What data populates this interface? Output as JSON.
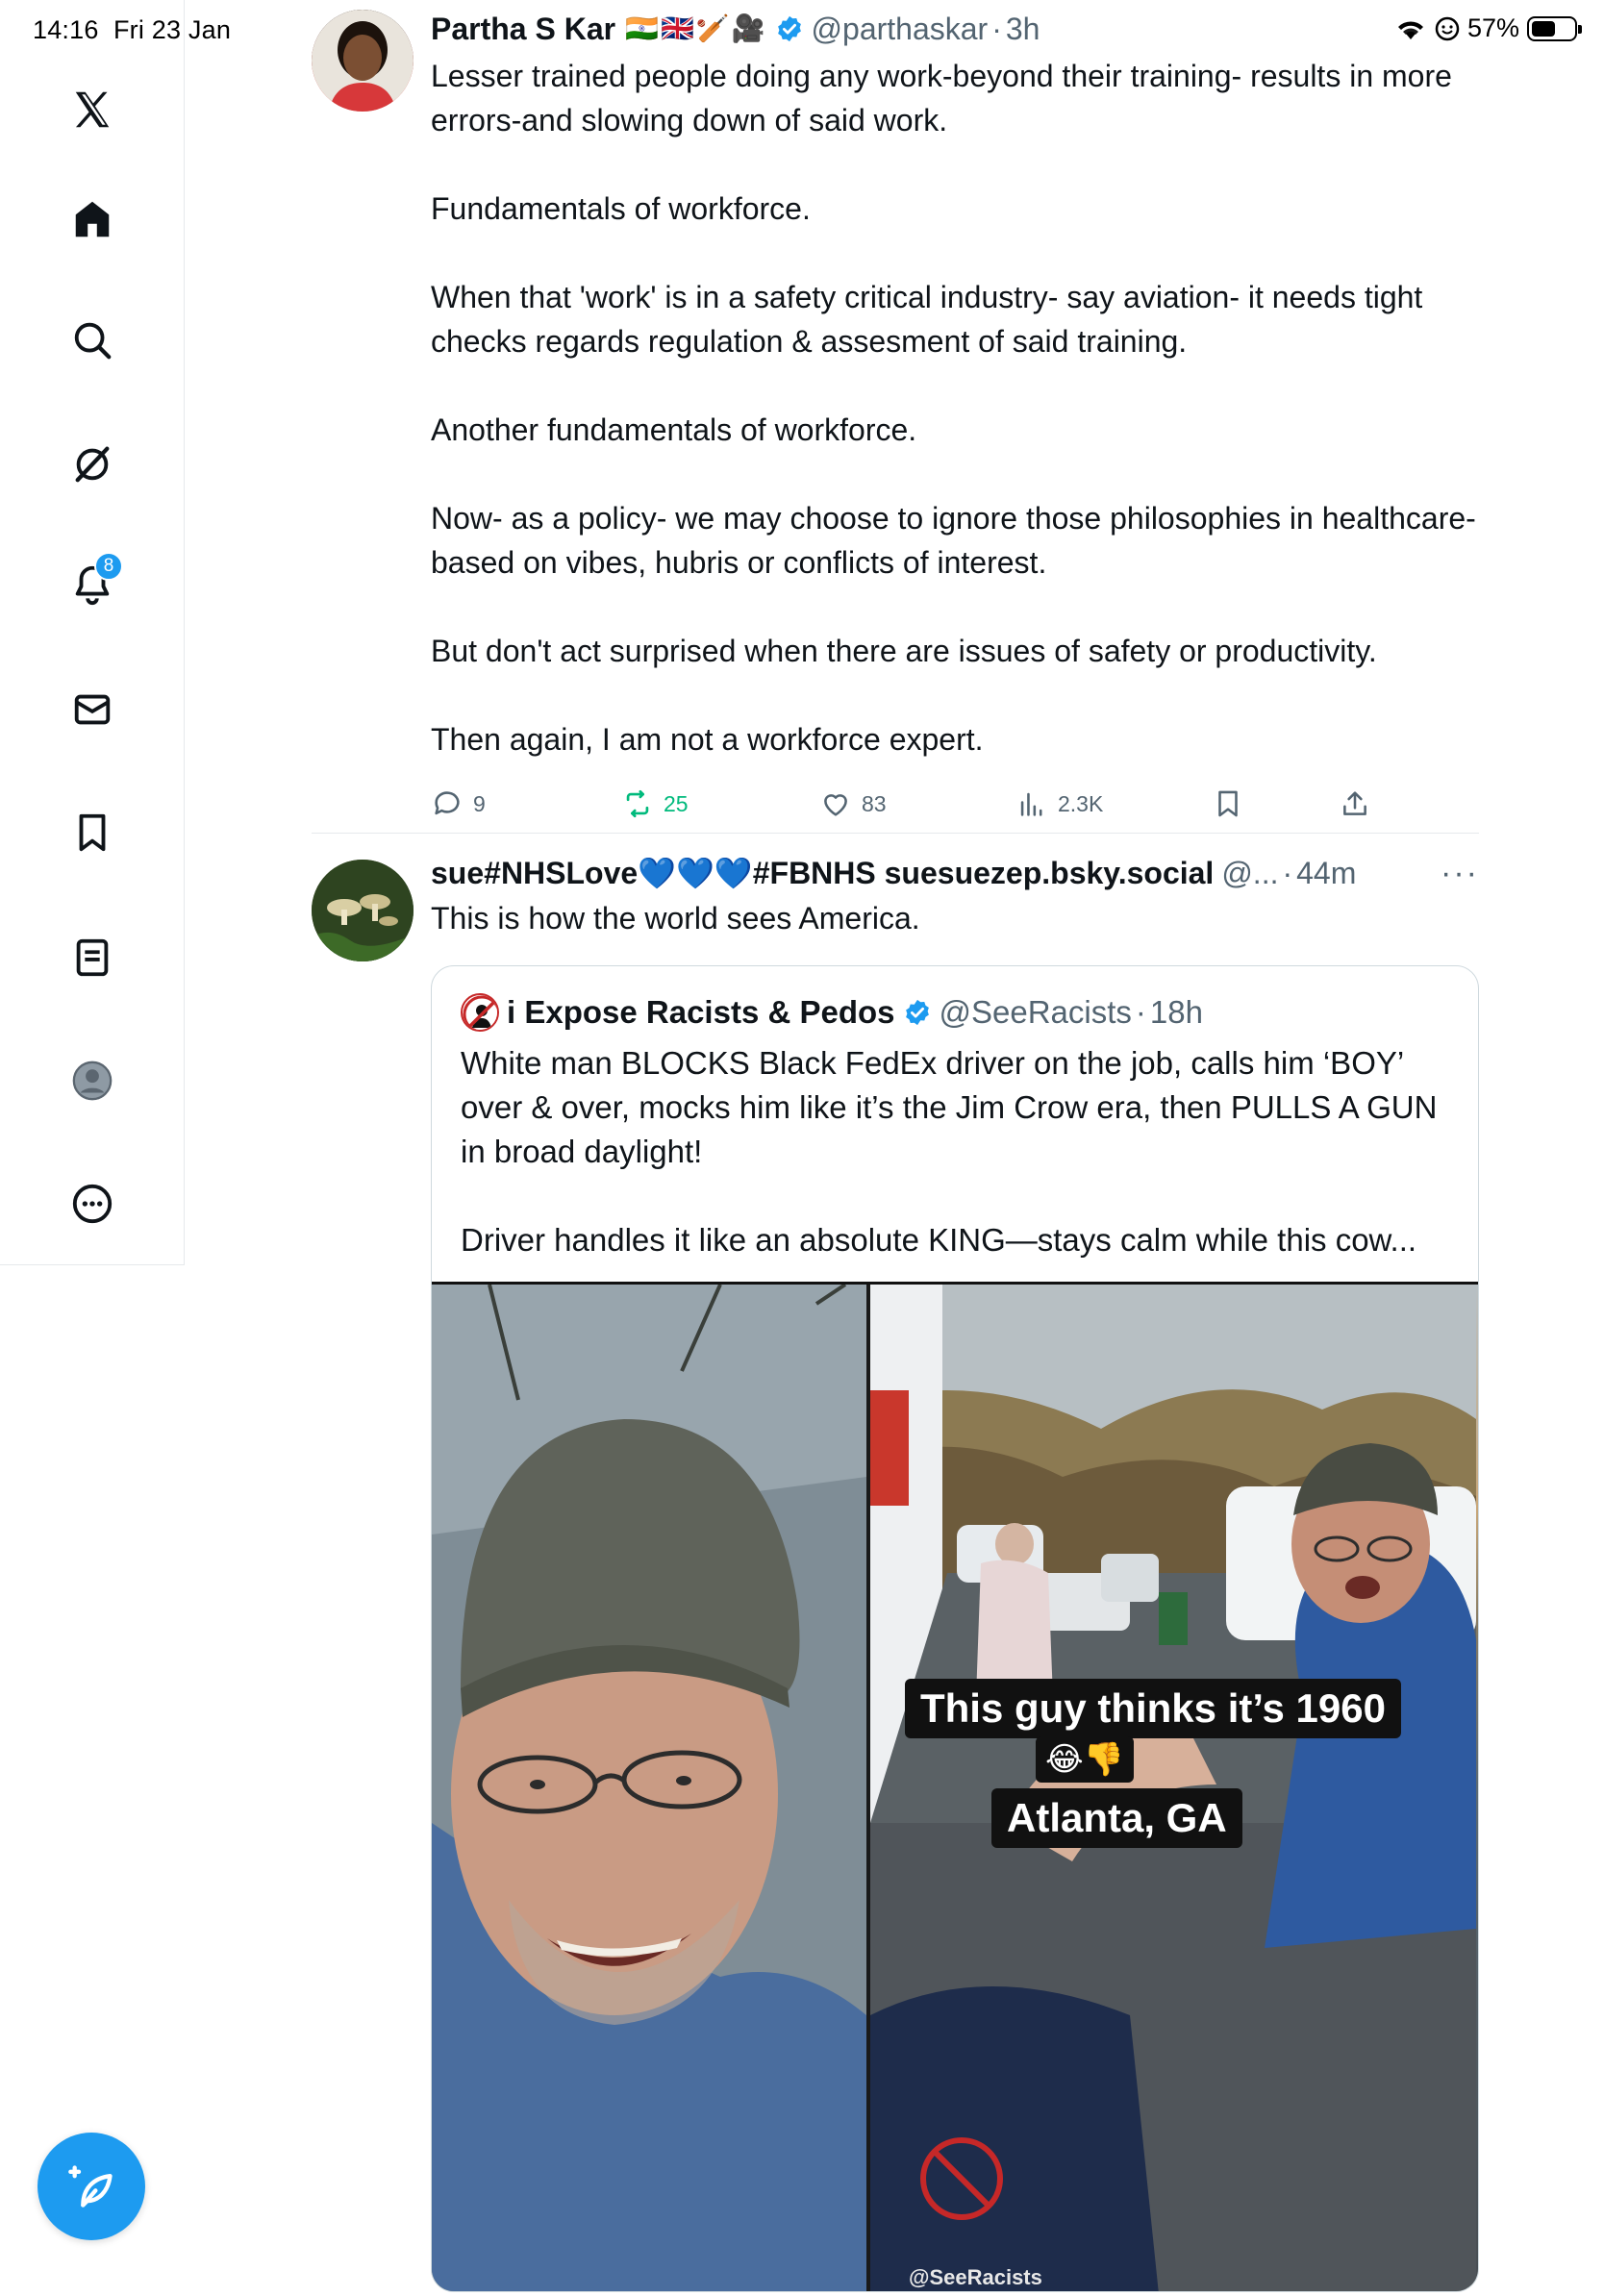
{
  "status_bar": {
    "time": "14:16",
    "date": "Fri 23 Jan",
    "battery": "57%",
    "battery_level": 0.57
  },
  "sidebar": {
    "items": [
      {
        "name": "x-logo-icon"
      },
      {
        "name": "home-icon"
      },
      {
        "name": "search-icon"
      },
      {
        "name": "grok-icon"
      },
      {
        "name": "notifications-icon",
        "badge": "8"
      },
      {
        "name": "messages-icon"
      },
      {
        "name": "bookmarks-icon"
      },
      {
        "name": "lists-icon"
      },
      {
        "name": "profile-icon"
      },
      {
        "name": "more-icon"
      }
    ],
    "compose": "compose-icon"
  },
  "tweets": [
    {
      "name": "Partha S Kar",
      "flags": "🇮🇳🇬🇧🏏🎥",
      "handle": "@parthaskar",
      "time": "3h",
      "text": "Lesser trained people doing any work-beyond their training- results in more errors-and slowing down of said work.\n\nFundamentals of workforce.\n\nWhen that 'work' is in a safety critical industry- say aviation- it needs tight checks regards regulation & assesment of said training.\n\nAnother fundamentals of workforce.\n\nNow- as a policy- we may choose to ignore those philosophies in healthcare- based on vibes, hubris or conflicts of interest.\n\nBut don't act surprised when there are issues of safety or productivity.\n\nThen again, I am not a workforce expert.",
      "replies": "9",
      "reposts": "25",
      "likes": "83",
      "views": "2.3K"
    },
    {
      "name": "sue#NHSLove💙💙💙#FBNHS suesuezep.bsky.social",
      "handle": "@...",
      "time": "44m",
      "text": "This is how the world sees America.",
      "quote": {
        "name": "i Expose Racists & Pedos",
        "handle": "@SeeRacists",
        "time": "18h",
        "text": "White man BLOCKS Black FedEx driver on the job, calls him ‘BOY’ over & over, mocks him like it’s the Jim Crow era, then PULLS A GUN in broad daylight!\n\nDriver handles it like an absolute KING—stays calm while this cow...",
        "video_caption_1": "This guy thinks it’s 1960",
        "video_caption_emoji": "😂👎",
        "video_caption_2": "Atlanta, GA",
        "watermark": "@SeeRacists"
      }
    }
  ],
  "colors": {
    "accent": "#1d9bf0",
    "repost_green": "#00ba7c",
    "secondary_text": "#536471"
  }
}
